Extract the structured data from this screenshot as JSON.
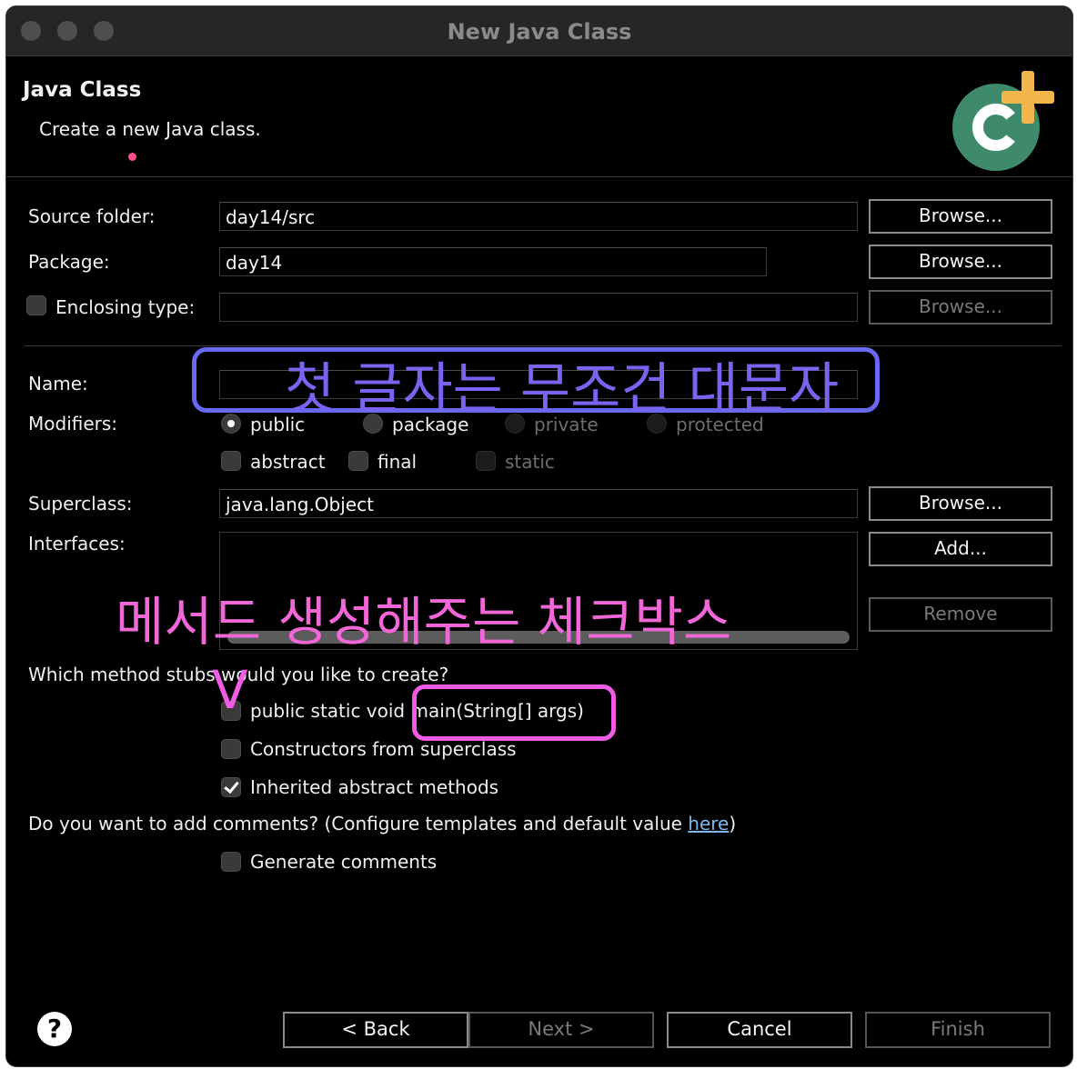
{
  "window": {
    "title": "New Java Class"
  },
  "header": {
    "title": "Java Class",
    "description": "Create a new Java class."
  },
  "form": {
    "source_folder": {
      "label": "Source folder:",
      "value": "day14/src",
      "browse": "Browse..."
    },
    "package": {
      "label": "Package:",
      "value": "day14",
      "browse": "Browse..."
    },
    "enclosing_type": {
      "label": "Enclosing type:",
      "value": "",
      "checked": false,
      "browse": "Browse..."
    },
    "name": {
      "label": "Name:",
      "value": ""
    },
    "modifiers": {
      "label": "Modifiers:",
      "access": [
        {
          "label": "public",
          "selected": true,
          "enabled": true
        },
        {
          "label": "package",
          "selected": false,
          "enabled": true
        },
        {
          "label": "private",
          "selected": false,
          "enabled": false
        },
        {
          "label": "protected",
          "selected": false,
          "enabled": false
        }
      ],
      "flags": [
        {
          "label": "abstract",
          "checked": false,
          "enabled": true
        },
        {
          "label": "final",
          "checked": false,
          "enabled": true
        },
        {
          "label": "static",
          "checked": false,
          "enabled": false
        }
      ]
    },
    "superclass": {
      "label": "Superclass:",
      "value": "java.lang.Object",
      "browse": "Browse..."
    },
    "interfaces": {
      "label": "Interfaces:",
      "items": [],
      "add": "Add...",
      "remove": "Remove"
    },
    "method_stubs": {
      "question": "Which method stubs would you like to create?",
      "options": [
        {
          "label": "public static void main(String[] args)",
          "checked": false
        },
        {
          "label": "Constructors from superclass",
          "checked": false
        },
        {
          "label": "Inherited abstract methods",
          "checked": true
        }
      ]
    },
    "comments": {
      "question_prefix": "Do you want to add comments? (Configure templates and default value ",
      "link": "here",
      "question_suffix": ")",
      "generate_label": "Generate comments",
      "checked": false
    }
  },
  "annotations": {
    "name_note": "첫 글자는 무조건 대문자",
    "method_note": "메서드 생성해주는 체크박스",
    "check_mark": "V",
    "colors": {
      "blue": "#6868f2",
      "pink": "#f05ce6"
    }
  },
  "footer": {
    "help": "?",
    "back": "< Back",
    "next": "Next >",
    "cancel": "Cancel",
    "finish": "Finish"
  },
  "icons": {
    "wizard_icon": "new-class-c-plus-icon",
    "help_icon": "question-mark-icon"
  }
}
